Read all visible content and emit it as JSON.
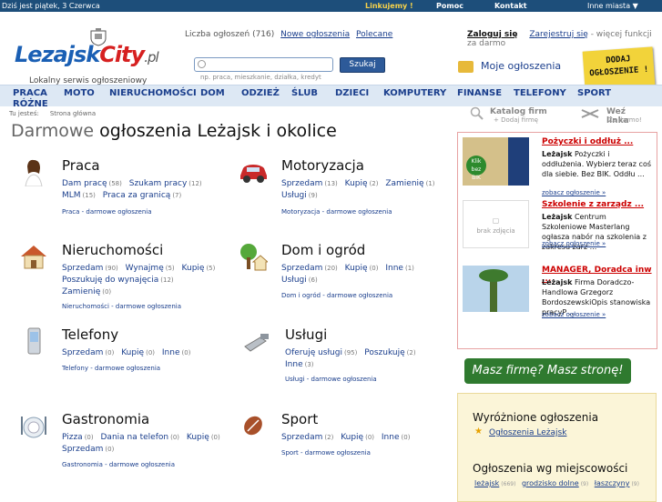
{
  "topbar": {
    "date": "Dziś jest piątek, 3 Czerwca",
    "link1": "Linkujemy !",
    "link2": "Pomoc",
    "link3": "Kontakt",
    "city_select": "Inne miasta ▼"
  },
  "header": {
    "logo_main": "Lezajsk",
    "logo_city": "City",
    "logo_tld": ".pl",
    "tagline": "Lokalny serwis ogłoszeniowy",
    "stats_label": "Liczba ogłoszeń (716)",
    "stats_new": "Nowe ogłoszenia",
    "stats_recommended": "Polecane",
    "search_placeholder": "",
    "search_button": "Szukaj",
    "search_hint": "np. praca, mieszkanie, działka, kredyt",
    "login": "Zaloguj się",
    "register": "Zarejestruj się",
    "register_suffix": " - więcej funkcji za darmo",
    "my_ads": "Moje ogłoszenia",
    "add_ad_1": "DODAJ",
    "add_ad_2": "OGŁOSZENIE !"
  },
  "nav": [
    "PRACA",
    "MOTO",
    "NIERUCHOMOŚCI",
    "DOM",
    "ODZIEŻ",
    "ŚLUB",
    "DZIECI",
    "KOMPUTERY",
    "FINANSE",
    "TELEFONY",
    "SPORT"
  ],
  "nav_more": "RÓŻNE",
  "breadcrumb": {
    "label": "Tu jesteś:",
    "current": "Strona główna"
  },
  "catalog": {
    "label": "Katalog firm",
    "sub": "+ Dodaj firmę",
    "swap": "Weź linka",
    "swap_sub": "Za darmo!"
  },
  "title": {
    "bold": "Darmowe",
    "rest": " ogłoszenia Leżajsk i okolice"
  },
  "categories": [
    {
      "title": "Praca",
      "links": [
        [
          "Dam pracę",
          "(58)"
        ],
        [
          "Szukam pracy",
          "(12)"
        ],
        [
          "MLM",
          "(15)"
        ],
        [
          "Praca za granicą",
          "(7)"
        ]
      ],
      "foot": "Praca - darmowe ogłoszenia"
    },
    {
      "title": "Motoryzacja",
      "links": [
        [
          "Sprzedam",
          "(13)"
        ],
        [
          "Kupię",
          "(2)"
        ],
        [
          "Zamienię",
          "(1)"
        ],
        [
          "Usługi",
          "(9)"
        ]
      ],
      "foot": "Motoryzacja - darmowe ogłoszenia"
    },
    {
      "title": "Nieruchomości",
      "links": [
        [
          "Sprzedam",
          "(90)"
        ],
        [
          "Wynajmę",
          "(5)"
        ],
        [
          "Kupię",
          "(5)"
        ],
        [
          "Poszukuję do wynajęcia",
          "(12)"
        ],
        [
          "Zamienię",
          "(0)"
        ]
      ],
      "foot": "Nieruchomości - darmowe ogłoszenia"
    },
    {
      "title": "Dom i ogród",
      "links": [
        [
          "Sprzedam",
          "(20)"
        ],
        [
          "Kupię",
          "(0)"
        ],
        [
          "Inne",
          "(1)"
        ],
        [
          "Usługi",
          "(6)"
        ]
      ],
      "foot": "Dom i ogród - darmowe ogłoszenia"
    },
    {
      "title": "Telefony",
      "links": [
        [
          "Sprzedam",
          "(0)"
        ],
        [
          "Kupię",
          "(0)"
        ],
        [
          "Inne",
          "(0)"
        ]
      ],
      "foot": "Telefony - darmowe ogłoszenia"
    },
    {
      "title": "Usługi",
      "links": [
        [
          "Oferuję usługi",
          "(95)"
        ],
        [
          "Poszukuję",
          "(2)"
        ],
        [
          "Inne",
          "(3)"
        ]
      ],
      "foot": "Usługi - darmowe ogłoszenia"
    },
    {
      "title": "Gastronomia",
      "links": [
        [
          "Pizza",
          "(0)"
        ],
        [
          "Dania na telefon",
          "(0)"
        ],
        [
          "Kupię",
          "(0)"
        ],
        [
          "Sprzedam",
          "(0)"
        ]
      ],
      "foot": "Gastronomia - darmowe ogłoszenia"
    },
    {
      "title": "Sport",
      "links": [
        [
          "Sprzedam",
          "(2)"
        ],
        [
          "Kupię",
          "(0)"
        ],
        [
          "Inne",
          "(0)"
        ]
      ],
      "foot": "Sport - darmowe ogłoszenia"
    }
  ],
  "side_ads": [
    {
      "title": "Pożyczki i oddłuż ...",
      "city": "Leżajsk",
      "desc": " Pożyczki i oddłużenia. Wybierz teraz coś dla siebie. Bez BIK. Oddłu ...",
      "more": "zobacz ogłoszenie »",
      "img": "Klik bez BIK"
    },
    {
      "title": "Szkolenie z zarządz ...",
      "city": "Leżajsk",
      "desc": " Centrum Szkoleniowe Masterlang ogłasza nabór na szkolenia z zakresu zarz ...",
      "more": "zobacz ogłoszenie »",
      "img": "brak zdjęcia"
    },
    {
      "title": "MANAGER, Doradca inw ...",
      "city": "Leżajsk",
      "desc": " Firma Doradczo-Handlowa Grzegorz BordoszewskiOpis stanowiska pracyP ...",
      "more": "zobacz ogłoszenie »",
      "img": ""
    }
  ],
  "promo": "Masz firmę? Masz stronę!",
  "featured": {
    "title": "Wyróżnione ogłoszenia",
    "link": "Ogłoszenia Leżajsk",
    "title2": "Ogłoszenia wg miejscowości",
    "places": [
      [
        "leżajsk",
        "(669)"
      ],
      [
        "grodzisko dolne",
        "(9)"
      ],
      [
        "łaszczyny",
        "(9)"
      ]
    ]
  }
}
